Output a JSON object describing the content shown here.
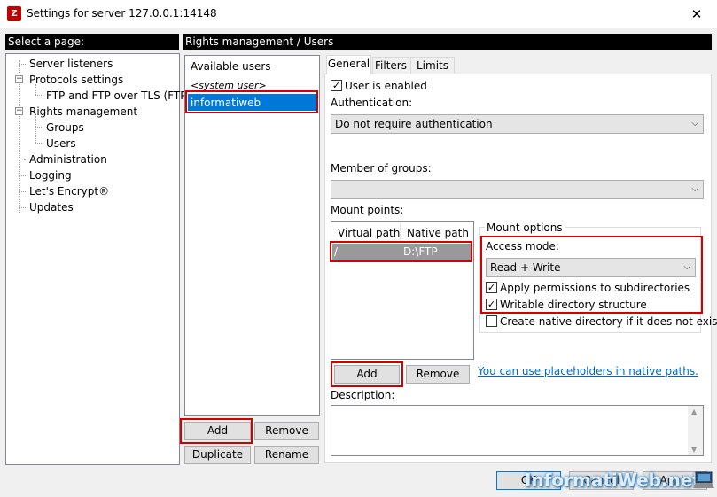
{
  "window": {
    "title": "Settings for server 127.0.0.1:14148",
    "close_glyph": "✕",
    "app_icon_letter": "Z"
  },
  "left": {
    "header": "Select a page:",
    "tree": [
      "Server listeners",
      "Protocols settings",
      "FTP and FTP over TLS (FTPS)",
      "Rights management",
      "Groups",
      "Users",
      "Administration",
      "Logging",
      "Let's Encrypt®",
      "Updates"
    ]
  },
  "right": {
    "header": "Rights management / Users"
  },
  "users": {
    "heading": "Available users",
    "items": [
      "<system user>",
      "informatiweb"
    ],
    "selected": "informatiweb",
    "add": "Add",
    "remove": "Remove",
    "duplicate": "Duplicate",
    "rename": "Rename"
  },
  "tabs": [
    "General",
    "Filters",
    "Limits"
  ],
  "general": {
    "user_enabled": "User is enabled",
    "auth_label": "Authentication:",
    "auth_value": "Do not require authentication",
    "member_label": "Member of groups:",
    "member_value": "",
    "mount_label": "Mount points:",
    "col_virtual": "Virtual path",
    "col_native": "Native path",
    "mount_rows": [
      {
        "virtual": "/",
        "native": "D:\\FTP"
      }
    ],
    "add": "Add",
    "remove": "Remove",
    "placeholder_link": "You can use placeholders in native paths.",
    "description_label": "Description:",
    "description_value": ""
  },
  "mount_options": {
    "legend": "Mount options",
    "access_label": "Access mode:",
    "access_value": "Read + Write",
    "apply_perm": "Apply permissions to subdirectories",
    "writable": "Writable directory structure",
    "create_native": "Create native directory if it does not exist",
    "apply_perm_checked": true,
    "writable_checked": true,
    "create_native_checked": false
  },
  "footer": {
    "ok": "OK",
    "cancel": "Cancel",
    "apply": "Apply"
  },
  "watermark": "InformatiWeb.net",
  "colors": {
    "highlight": "#0078d7",
    "grey_selection": "#999999",
    "annotation": "#d40000",
    "link": "#0066cc"
  }
}
